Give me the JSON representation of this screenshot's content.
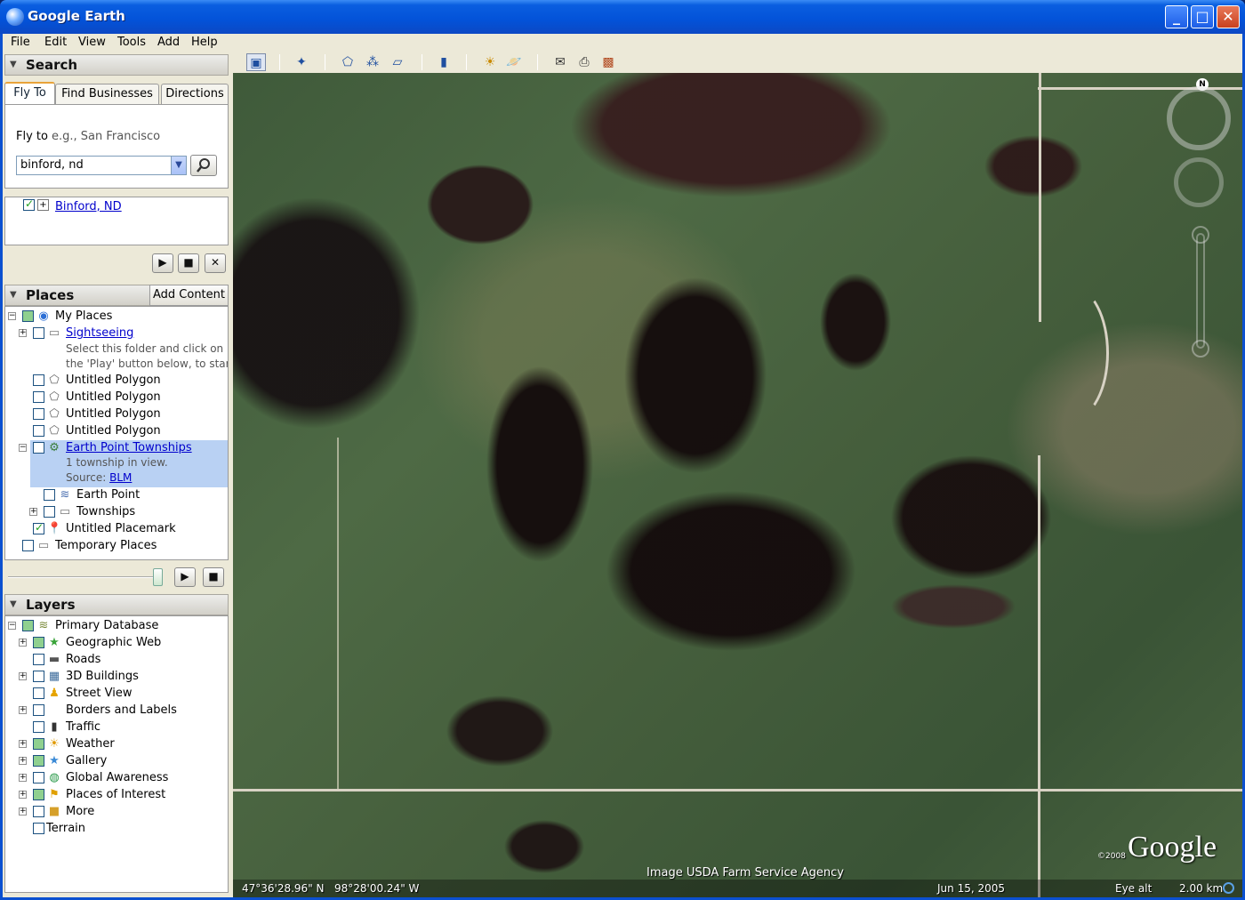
{
  "window": {
    "title": "Google Earth"
  },
  "menu": [
    "File",
    "Edit",
    "View",
    "Tools",
    "Add",
    "Help"
  ],
  "search": {
    "header": "Search",
    "tabs": [
      "Fly To",
      "Find Businesses",
      "Directions"
    ],
    "fly_to_label": "Fly to",
    "fly_to_hint": "e.g., San Francisco",
    "query": "binford, nd",
    "result": "Binford, ND"
  },
  "places": {
    "header": "Places",
    "add_content": "Add Content",
    "items": [
      {
        "label": "My Places"
      },
      {
        "label": "Sightseeing",
        "desc1": "Select this folder and click on",
        "desc2": "the 'Play' button below, to start"
      },
      {
        "label": "Untitled Polygon"
      },
      {
        "label": "Untitled Polygon"
      },
      {
        "label": "Untitled Polygon"
      },
      {
        "label": "Untitled Polygon"
      },
      {
        "label": "Earth Point Townships",
        "desc1": "1 township in view.",
        "source_label": "Source:",
        "source_link": "BLM"
      },
      {
        "label": "Earth Point"
      },
      {
        "label": "Townships"
      },
      {
        "label": "Untitled Placemark"
      },
      {
        "label": "Temporary Places"
      }
    ]
  },
  "layers": {
    "header": "Layers",
    "items": [
      {
        "label": "Primary Database"
      },
      {
        "label": "Geographic Web"
      },
      {
        "label": "Roads"
      },
      {
        "label": "3D Buildings"
      },
      {
        "label": "Street View"
      },
      {
        "label": "Borders and Labels"
      },
      {
        "label": "Traffic"
      },
      {
        "label": "Weather"
      },
      {
        "label": "Gallery"
      },
      {
        "label": "Global Awareness"
      },
      {
        "label": "Places of Interest"
      },
      {
        "label": "More"
      },
      {
        "label": "Terrain"
      }
    ]
  },
  "map": {
    "attribution": "Image USDA Farm Service Agency",
    "latitude": "47°36'28.96\" N",
    "longitude": "98°28'00.24\" W",
    "imagery_date": "Jun 15, 2005",
    "eye_alt_label": "Eye alt",
    "eye_alt": "2.00 km",
    "copyright_year": "©2008",
    "logo": "Google",
    "north": "N"
  },
  "colors": {
    "titlebar": "#0352d8",
    "chrome": "#ece9d8",
    "selection": "#b9d1f3",
    "link": "#0000cc"
  }
}
